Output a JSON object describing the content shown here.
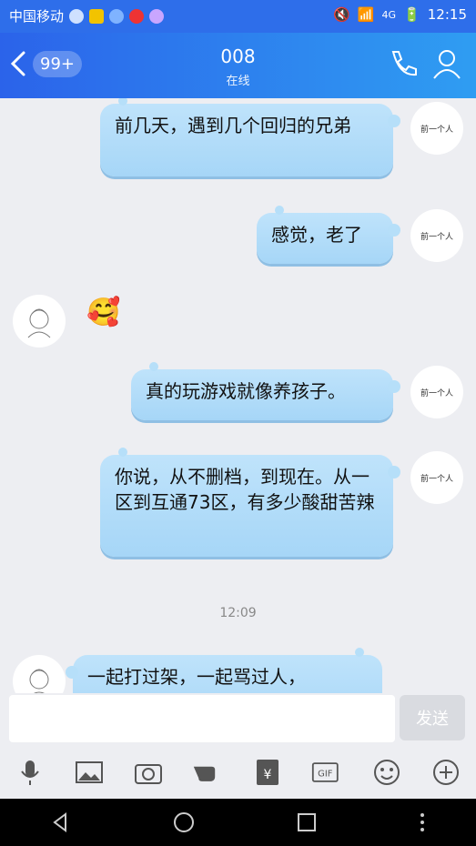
{
  "status": {
    "carrier": "中国移动",
    "network": "4G",
    "time": "12:15"
  },
  "header": {
    "back_badge": "99+",
    "title": "008",
    "subtitle": "在线"
  },
  "messages": [
    {
      "side": "right",
      "text": "前几天，遇到几个回归的兄弟"
    },
    {
      "side": "right",
      "text": "感觉，老了"
    },
    {
      "side": "left",
      "type": "emoji",
      "text": "🥰"
    },
    {
      "side": "right",
      "text": "真的玩游戏就像养孩子。"
    },
    {
      "side": "right",
      "text": "你说，从不删档，到现在。从一区到互通73区，有多少酸甜苦辣"
    },
    {
      "side": "left",
      "text": "一起打过架，一起骂过人，"
    }
  ],
  "timestamp": "12:09",
  "composer": {
    "placeholder": "",
    "send_label": "发送"
  },
  "avatar_text_me": "前一个人",
  "toolbar_icons": [
    "microphone-icon",
    "image-icon",
    "camera-icon",
    "hand-icon",
    "red-envelope-icon",
    "gif-icon",
    "emoji-icon",
    "plus-icon"
  ],
  "nav_icons": [
    "back-icon",
    "home-icon",
    "recent-icon",
    "more-icon"
  ]
}
